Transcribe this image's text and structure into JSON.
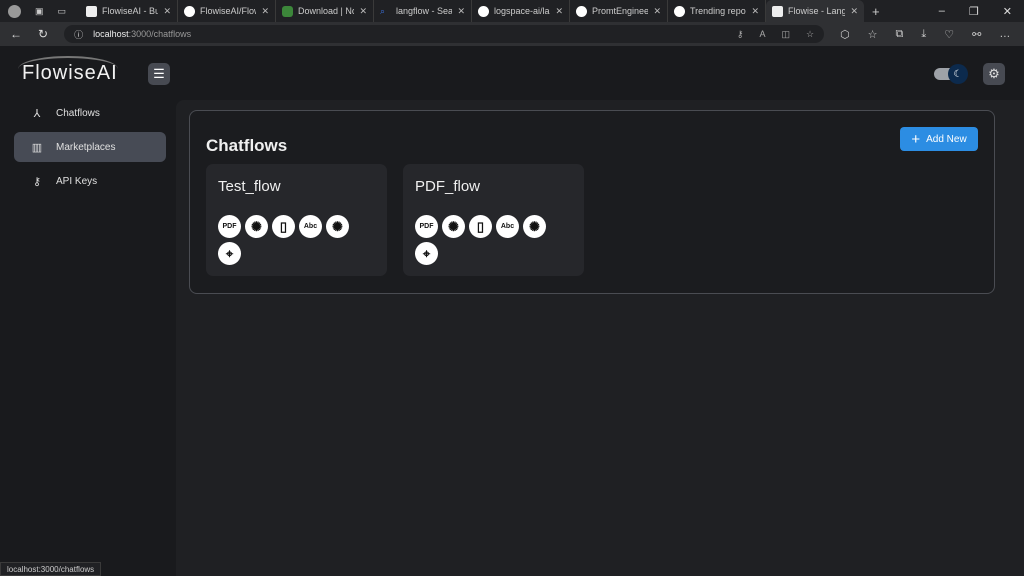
{
  "browser": {
    "tabs": [
      {
        "title": "FlowiseAI - Buil",
        "icon": "page"
      },
      {
        "title": "FlowiseAI/Flowis",
        "icon": "github"
      },
      {
        "title": "Download | Nod",
        "icon": "node"
      },
      {
        "title": "langflow - Searc",
        "icon": "search"
      },
      {
        "title": "logspace-ai/lan",
        "icon": "github"
      },
      {
        "title": "PromtEngineer/",
        "icon": "github"
      },
      {
        "title": "Trending reposi",
        "icon": "github"
      },
      {
        "title": "Flowise - Langc",
        "icon": "page",
        "active": true
      }
    ],
    "url_host": "localhost",
    "url_path": ":3000/chatflows",
    "status_url": "localhost:3000/chatflows"
  },
  "app": {
    "logo": "FlowiseAI",
    "nav": [
      {
        "label": "Chatflows",
        "icon": "chatflows-icon"
      },
      {
        "label": "Marketplaces",
        "icon": "store-icon",
        "selected": true
      },
      {
        "label": "API Keys",
        "icon": "key-icon"
      }
    ],
    "page_title": "Chatflows",
    "add_new_label": "Add New",
    "chatflows": [
      {
        "name": "Test_flow",
        "nodes": [
          "PDF",
          "openai",
          "doc",
          "Abc",
          "openai",
          "chroma"
        ]
      },
      {
        "name": "PDF_flow",
        "nodes": [
          "PDF",
          "openai",
          "doc",
          "Abc",
          "openai",
          "chroma"
        ]
      }
    ]
  },
  "colors": {
    "accent": "#2c8de3",
    "selected_nav": "#474b55",
    "card": "#26272b"
  }
}
